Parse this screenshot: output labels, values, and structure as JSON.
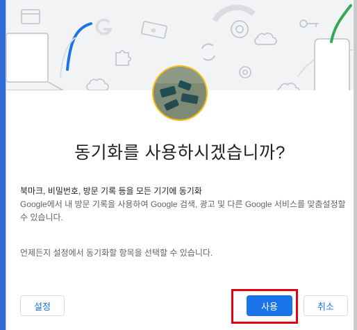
{
  "dialog": {
    "title": "동기화를 사용하시겠습니까?",
    "sync_heading": "북마크, 비밀번호, 방문 기록 등을 모든 기기에 동기화",
    "sync_desc": "Google에서 내 방문 기록을 사용하여 Google 검색, 광고 및 다른 Google 서비스를 맞춤설정할 수 있습니다.",
    "note": "언제든지 설정에서 동기화할 항목을 선택할 수 있습니다.",
    "buttons": {
      "settings": "설정",
      "ok": "사용",
      "cancel": "취소"
    }
  },
  "colors": {
    "accent": "#1a73e8",
    "highlight": "#e3000f",
    "avatar_ring": "#fbbc04"
  },
  "icons": [
    "window-icon",
    "laptop-icon",
    "google-g-icon",
    "extension-puzzle-icon",
    "ticket-icon",
    "sync-icon",
    "chrome-icon",
    "gear-icon",
    "cloud-icon",
    "key-icon",
    "phone-icon"
  ]
}
